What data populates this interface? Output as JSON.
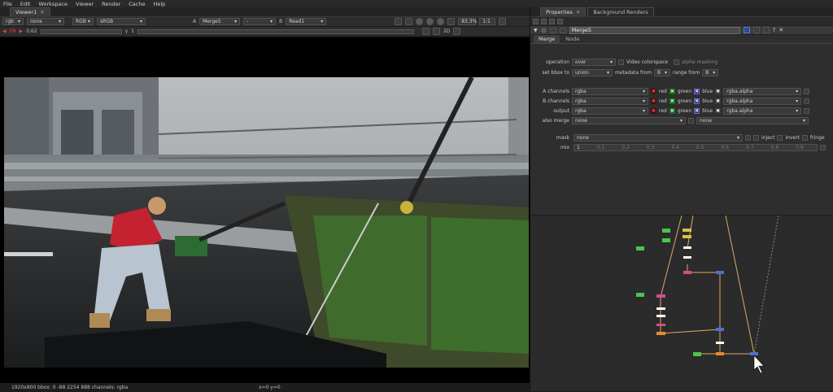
{
  "menu": [
    "File",
    "Edit",
    "Workspace",
    "Viewer",
    "Render",
    "Cache",
    "Help"
  ],
  "viewer": {
    "tab_label": "Viewer1",
    "toolbar1": {
      "channels": "rgb",
      "alpha": "none",
      "colorspace_channels": "RGB",
      "display": "sRGB",
      "a_input_label": "A",
      "a_input": "Merge5",
      "compare": "-",
      "b_input_label": "B",
      "b_input": "Read1",
      "zoom": "83.3%",
      "proxy": "1:1"
    },
    "toolbar2": {
      "fstop_label": "f/8",
      "gain": "0.62",
      "frame_value": "1",
      "mode": "2D"
    },
    "status": {
      "info": "1920x800  bbox: 0 -88 2254 888 channels: rgba",
      "cursor": "x=0 y=0"
    }
  },
  "properties": {
    "tabs": [
      "Properties",
      "Background Renders"
    ],
    "node_name": "Merge5",
    "subtabs": [
      "Merge",
      "Node"
    ],
    "operation": {
      "label": "operation",
      "value": "over"
    },
    "video_colorspace": "Video colorspace",
    "alpha_masking": "alpha masking",
    "set_bbox": {
      "label": "set bbox to",
      "value": "union"
    },
    "metadata_from": {
      "label": "metadata from",
      "value": "B"
    },
    "range_from": {
      "label": "range from",
      "value": "B"
    },
    "a_channels": {
      "label": "A channels",
      "value": "rgba",
      "alpha_value": "rgba.alpha"
    },
    "b_channels": {
      "label": "B channels",
      "value": "rgba",
      "alpha_value": "rgba.alpha"
    },
    "output": {
      "label": "output",
      "value": "rgba",
      "alpha_value": "rgba.alpha"
    },
    "also_merge": {
      "label": "also merge",
      "value": "none",
      "value2": "none"
    },
    "channel_labels": {
      "red": "red",
      "green": "green",
      "blue": "blue"
    },
    "mask": {
      "label": "mask",
      "value": "none"
    },
    "inject": "inject",
    "invert": "invert",
    "fringe": "fringe",
    "mix": {
      "label": "mix",
      "value": "1"
    },
    "mix_ticks": [
      "0",
      "0.1",
      "0.2",
      "0.3",
      "0.4",
      "0.5",
      "0.6",
      "0.7",
      "0.8",
      "0.9",
      "1"
    ]
  },
  "colors": {
    "accent": "#4a90d9",
    "node_yellow": "#d9c23f",
    "node_pink": "#d44c8e",
    "node_orange": "#e68a2e",
    "node_green": "#4cc44c",
    "pipe": "#e0a860",
    "dot_blue": "#4a70d0"
  }
}
